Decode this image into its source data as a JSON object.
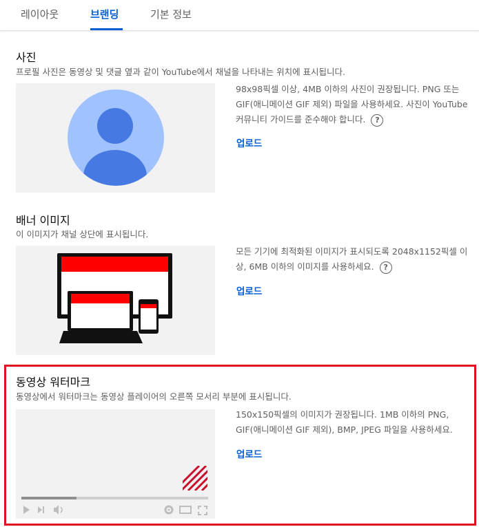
{
  "tabs": [
    {
      "label": "레이아웃"
    },
    {
      "label": "브랜딩"
    },
    {
      "label": "기본 정보"
    }
  ],
  "photo": {
    "title": "사진",
    "description": "프로필 사진은 동영상 및 댓글 옆과 같이 YouTube에서 채널을 나타내는 위치에 표시됩니다.",
    "info": "98x98픽셀 이상, 4MB 이하의 사진이 권장됩니다. PNG 또는 GIF(애니메이션 GIF 제외) 파일을 사용하세요. 사진이 YouTube 커뮤니티 가이드를 준수해야 합니다.",
    "upload": "업로드"
  },
  "banner": {
    "title": "배너 이미지",
    "description": "이 이미지가 채널 상단에 표시됩니다.",
    "info": "모든 기기에 최적화된 이미지가 표시되도록 2048x1152픽셀 이상, 6MB 이하의 이미지를 사용하세요.",
    "upload": "업로드"
  },
  "watermark": {
    "title": "동영상 워터마크",
    "description": "동영상에서 워터마크는 동영상 플레이어의 오른쪽 모서리 부분에 표시됩니다.",
    "info": "150x150픽셀의 이미지가 권장됩니다. 1MB 이하의 PNG, GIF(애니메이션 GIF 제외), BMP, JPEG 파일을 사용하세요.",
    "upload": "업로드"
  },
  "help_glyph": "?",
  "colors": {
    "accent": "#065fd4",
    "highlight": "#e0101e",
    "banner_red": "#ff0000",
    "avatar_light": "#a0c3ff",
    "avatar_dark": "#4679e1"
  }
}
